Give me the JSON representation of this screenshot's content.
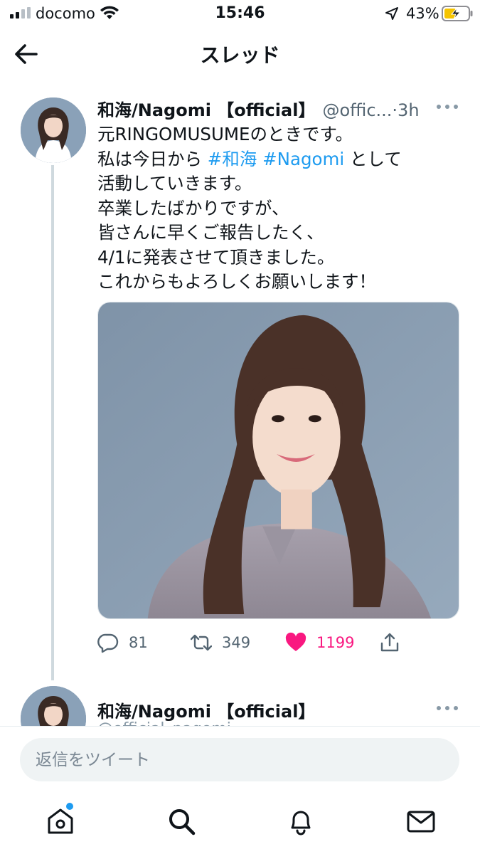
{
  "status_bar": {
    "carrier": "docomo",
    "time": "15:46",
    "battery_percent": "43%"
  },
  "header": {
    "title": "スレッド",
    "back_icon": "arrow-left-icon"
  },
  "tweet": {
    "display_name": "和海/Nagomi 【official】",
    "handle": "@offic...",
    "separator": "·",
    "timestamp": "3h",
    "body_lines": [
      [
        {
          "text": "元RINGOMUSUMEのときです。"
        }
      ],
      [
        {
          "text": "私は今日から "
        },
        {
          "text": "#和海",
          "tag": true
        },
        {
          "text": " "
        },
        {
          "text": "#Nagomi",
          "tag": true
        },
        {
          "text": " として"
        }
      ],
      [
        {
          "text": "活動していきます。"
        }
      ],
      [
        {
          "text": "卒業したばかりですが、"
        }
      ],
      [
        {
          "text": "皆さんに早くご報告したく、"
        }
      ],
      [
        {
          "text": "4/1に発表させて頂きました。"
        }
      ],
      [
        {
          "text": "これからもよろしくお願いします！"
        }
      ]
    ],
    "actions": {
      "reply_count": "81",
      "retweet_count": "349",
      "like_count": "1199",
      "like_color": "#f91880"
    }
  },
  "next_tweet": {
    "display_name": "和海/Nagomi 【official】",
    "handle_partial": "@official_nagomi"
  },
  "composer": {
    "placeholder": "返信をツイート"
  },
  "colors": {
    "accent": "#1d9bf0",
    "secondary_text": "#536471",
    "like": "#f91880"
  },
  "tab_bar": {
    "items": [
      "home-icon",
      "search-icon",
      "notifications-icon",
      "messages-icon"
    ]
  }
}
